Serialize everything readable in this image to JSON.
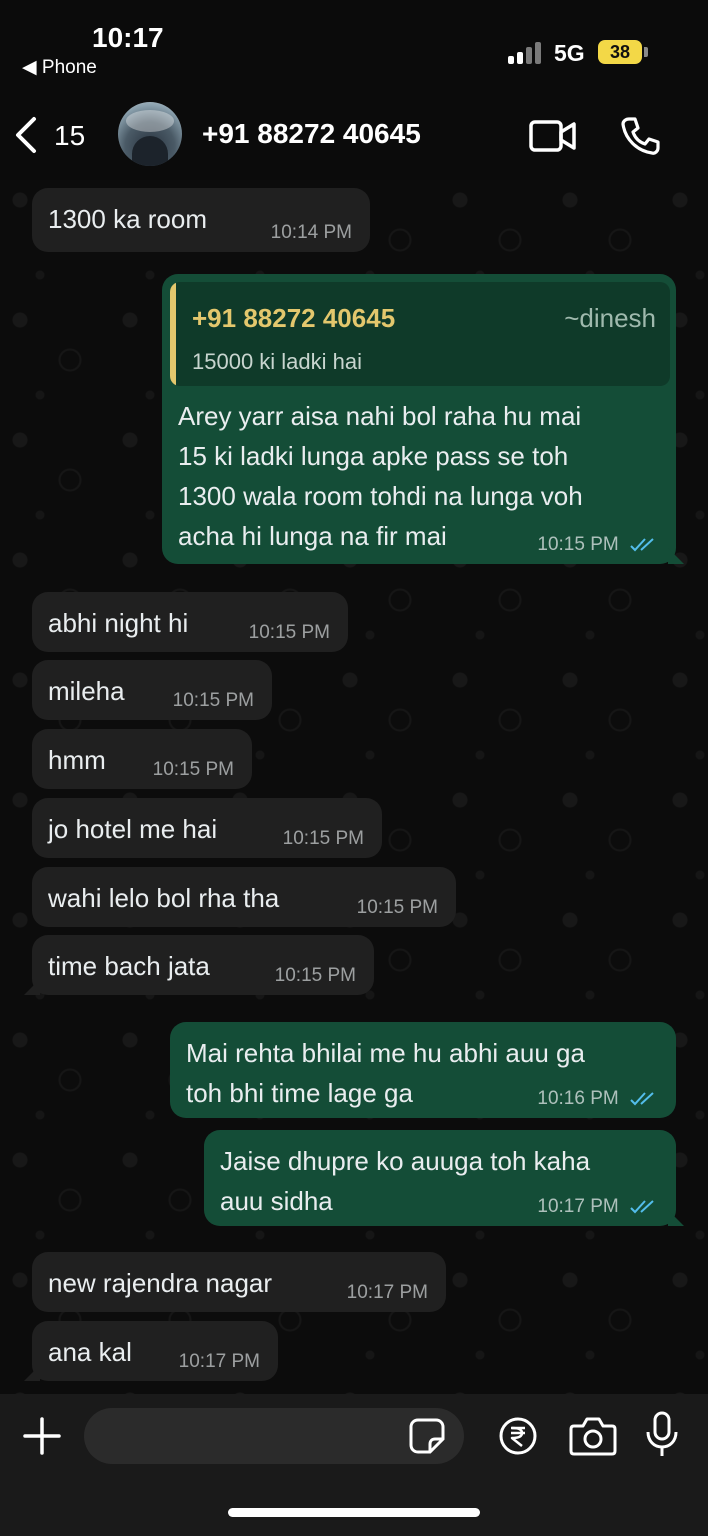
{
  "status_bar": {
    "time": "10:17",
    "back_app": "◀ Phone",
    "network": "5G",
    "battery": "38"
  },
  "header": {
    "back_count": "15",
    "contact_name": "+91 88272 40645"
  },
  "messages": [
    {
      "dir": "in",
      "text": "1300 ka room",
      "time": "10:14 PM"
    },
    {
      "dir": "out",
      "quote": {
        "author": "+91 88272 40645",
        "alias": "~dinesh",
        "text": "15000 ki ladki hai"
      },
      "text": "Arey yarr aisa nahi bol raha hu mai\n15 ki ladki lunga apke pass se toh\n1300 wala room tohdi na lunga voh\nacha hi lunga na fir mai",
      "time": "10:15 PM"
    },
    {
      "dir": "in",
      "text": "abhi night hi",
      "time": "10:15 PM"
    },
    {
      "dir": "in",
      "text": "mileha",
      "time": "10:15 PM"
    },
    {
      "dir": "in",
      "text": "hmm",
      "time": "10:15 PM"
    },
    {
      "dir": "in",
      "text": "jo hotel me hai",
      "time": "10:15 PM"
    },
    {
      "dir": "in",
      "text": "wahi lelo bol rha tha",
      "time": "10:15 PM"
    },
    {
      "dir": "in",
      "text": "time bach jata",
      "time": "10:15 PM"
    },
    {
      "dir": "out",
      "text": "Mai rehta bhilai me hu abhi auu ga\ntoh bhi time lage ga",
      "time": "10:16 PM"
    },
    {
      "dir": "out",
      "text": "Jaise dhupre ko auuga toh kaha\nauu sidha",
      "time": "10:17 PM"
    },
    {
      "dir": "in",
      "text": "new rajendra nagar",
      "time": "10:17 PM"
    },
    {
      "dir": "in",
      "text": "ana kal",
      "time": "10:17 PM"
    }
  ],
  "colors": {
    "incoming_bubble": "#202020",
    "outgoing_bubble": "#144d37",
    "read_ticks": "#53bdeb",
    "quote_author": "#e3c76d"
  },
  "icons": [
    "back-chevron-icon",
    "video-call-icon",
    "phone-call-icon",
    "plus-icon",
    "sticker-icon",
    "rupee-icon",
    "camera-icon",
    "microphone-icon",
    "double-check-icon"
  ]
}
